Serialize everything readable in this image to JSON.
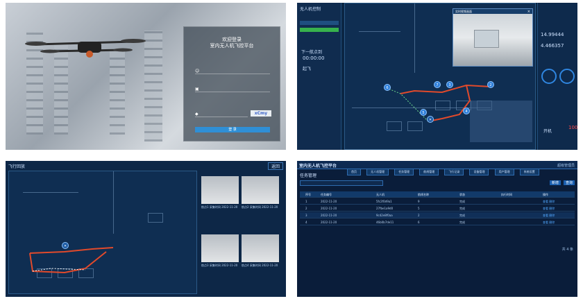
{
  "login": {
    "welcome": "欢迎登录",
    "platform": "室内无人机飞控平台",
    "captcha": "xCmy",
    "submit": "登 录"
  },
  "control": {
    "left_title": "无人机控制",
    "timer_label": "下一航点到",
    "timer": "00:00:00",
    "start": "起飞",
    "battery_value": "100",
    "gauge_a": "14.99444",
    "gauge_b": "4.466357",
    "waypoints": [
      "1",
      "2",
      "3",
      "4",
      "5",
      "6",
      "7"
    ],
    "floating_title": "实时视频画面",
    "power_label": "开机"
  },
  "records": {
    "title": "飞行回放",
    "back": "返回",
    "thumbs": [
      "航点1 采集时间 2022-11-20",
      "航点2 采集时间 2022-11-20",
      "航点3 采集时间 2022-11-20",
      "航点4 采集时间 2022-11-20"
    ]
  },
  "admin": {
    "brand": "室内无人机飞控平台",
    "nav": [
      "首页",
      "无人机管理",
      "任务管理",
      "航线管理",
      "飞行记录",
      "设备管理",
      "用户管理",
      "系统设置"
    ],
    "user": "超级管理员",
    "section": "任务管理",
    "add_btn": "新增",
    "search_btn": "查询",
    "headers": [
      "序号",
      "任务编号",
      "无人机",
      "航线名称",
      "状态",
      "执行时间",
      "操作"
    ],
    "rows": [
      [
        "1",
        "2022-11-20",
        "5fc2f0d9a1",
        "9",
        "完成",
        "查看 删除"
      ],
      [
        "2",
        "2022-11-20",
        "27fbe1a9d0",
        "5",
        "完成",
        "查看 删除"
      ],
      [
        "3",
        "2022-11-20",
        "9c42e8f0aa",
        "2",
        "完成",
        "查看 删除"
      ],
      [
        "4",
        "2022-11-20",
        "46b0b7de11",
        "6",
        "完成",
        "查看 删除"
      ]
    ],
    "pagination": "共 4 条"
  }
}
